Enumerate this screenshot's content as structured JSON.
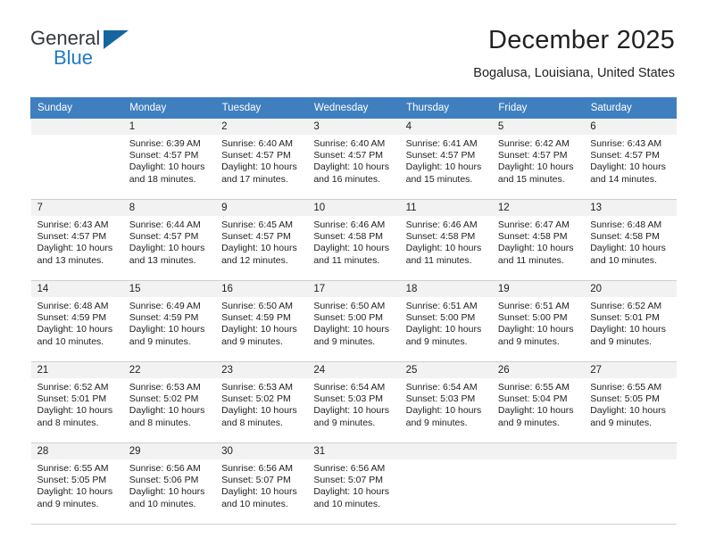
{
  "brand": {
    "word_one": "General",
    "word_two": "Blue",
    "logo_icon": "triangle-logo-icon",
    "accent_color": "#1e7bc4",
    "logo_color": "#15659f"
  },
  "header": {
    "month_title": "December 2025",
    "location": "Bogalusa, Louisiana, United States"
  },
  "calendar": {
    "header_bg": "#3f7fbf",
    "daynum_bg": "#f2f2f2",
    "weekday_headers": [
      "Sunday",
      "Monday",
      "Tuesday",
      "Wednesday",
      "Thursday",
      "Friday",
      "Saturday"
    ],
    "weeks": [
      [
        {
          "day": "",
          "blank": true,
          "sunrise": "",
          "sunset": "",
          "daylight": ""
        },
        {
          "day": "1",
          "blank": false,
          "sunrise": "Sunrise: 6:39 AM",
          "sunset": "Sunset: 4:57 PM",
          "daylight": "Daylight: 10 hours and 18 minutes."
        },
        {
          "day": "2",
          "blank": false,
          "sunrise": "Sunrise: 6:40 AM",
          "sunset": "Sunset: 4:57 PM",
          "daylight": "Daylight: 10 hours and 17 minutes."
        },
        {
          "day": "3",
          "blank": false,
          "sunrise": "Sunrise: 6:40 AM",
          "sunset": "Sunset: 4:57 PM",
          "daylight": "Daylight: 10 hours and 16 minutes."
        },
        {
          "day": "4",
          "blank": false,
          "sunrise": "Sunrise: 6:41 AM",
          "sunset": "Sunset: 4:57 PM",
          "daylight": "Daylight: 10 hours and 15 minutes."
        },
        {
          "day": "5",
          "blank": false,
          "sunrise": "Sunrise: 6:42 AM",
          "sunset": "Sunset: 4:57 PM",
          "daylight": "Daylight: 10 hours and 15 minutes."
        },
        {
          "day": "6",
          "blank": false,
          "sunrise": "Sunrise: 6:43 AM",
          "sunset": "Sunset: 4:57 PM",
          "daylight": "Daylight: 10 hours and 14 minutes."
        }
      ],
      [
        {
          "day": "7",
          "blank": false,
          "sunrise": "Sunrise: 6:43 AM",
          "sunset": "Sunset: 4:57 PM",
          "daylight": "Daylight: 10 hours and 13 minutes."
        },
        {
          "day": "8",
          "blank": false,
          "sunrise": "Sunrise: 6:44 AM",
          "sunset": "Sunset: 4:57 PM",
          "daylight": "Daylight: 10 hours and 13 minutes."
        },
        {
          "day": "9",
          "blank": false,
          "sunrise": "Sunrise: 6:45 AM",
          "sunset": "Sunset: 4:57 PM",
          "daylight": "Daylight: 10 hours and 12 minutes."
        },
        {
          "day": "10",
          "blank": false,
          "sunrise": "Sunrise: 6:46 AM",
          "sunset": "Sunset: 4:58 PM",
          "daylight": "Daylight: 10 hours and 11 minutes."
        },
        {
          "day": "11",
          "blank": false,
          "sunrise": "Sunrise: 6:46 AM",
          "sunset": "Sunset: 4:58 PM",
          "daylight": "Daylight: 10 hours and 11 minutes."
        },
        {
          "day": "12",
          "blank": false,
          "sunrise": "Sunrise: 6:47 AM",
          "sunset": "Sunset: 4:58 PM",
          "daylight": "Daylight: 10 hours and 11 minutes."
        },
        {
          "day": "13",
          "blank": false,
          "sunrise": "Sunrise: 6:48 AM",
          "sunset": "Sunset: 4:58 PM",
          "daylight": "Daylight: 10 hours and 10 minutes."
        }
      ],
      [
        {
          "day": "14",
          "blank": false,
          "sunrise": "Sunrise: 6:48 AM",
          "sunset": "Sunset: 4:59 PM",
          "daylight": "Daylight: 10 hours and 10 minutes."
        },
        {
          "day": "15",
          "blank": false,
          "sunrise": "Sunrise: 6:49 AM",
          "sunset": "Sunset: 4:59 PM",
          "daylight": "Daylight: 10 hours and 9 minutes."
        },
        {
          "day": "16",
          "blank": false,
          "sunrise": "Sunrise: 6:50 AM",
          "sunset": "Sunset: 4:59 PM",
          "daylight": "Daylight: 10 hours and 9 minutes."
        },
        {
          "day": "17",
          "blank": false,
          "sunrise": "Sunrise: 6:50 AM",
          "sunset": "Sunset: 5:00 PM",
          "daylight": "Daylight: 10 hours and 9 minutes."
        },
        {
          "day": "18",
          "blank": false,
          "sunrise": "Sunrise: 6:51 AM",
          "sunset": "Sunset: 5:00 PM",
          "daylight": "Daylight: 10 hours and 9 minutes."
        },
        {
          "day": "19",
          "blank": false,
          "sunrise": "Sunrise: 6:51 AM",
          "sunset": "Sunset: 5:00 PM",
          "daylight": "Daylight: 10 hours and 9 minutes."
        },
        {
          "day": "20",
          "blank": false,
          "sunrise": "Sunrise: 6:52 AM",
          "sunset": "Sunset: 5:01 PM",
          "daylight": "Daylight: 10 hours and 9 minutes."
        }
      ],
      [
        {
          "day": "21",
          "blank": false,
          "sunrise": "Sunrise: 6:52 AM",
          "sunset": "Sunset: 5:01 PM",
          "daylight": "Daylight: 10 hours and 8 minutes."
        },
        {
          "day": "22",
          "blank": false,
          "sunrise": "Sunrise: 6:53 AM",
          "sunset": "Sunset: 5:02 PM",
          "daylight": "Daylight: 10 hours and 8 minutes."
        },
        {
          "day": "23",
          "blank": false,
          "sunrise": "Sunrise: 6:53 AM",
          "sunset": "Sunset: 5:02 PM",
          "daylight": "Daylight: 10 hours and 8 minutes."
        },
        {
          "day": "24",
          "blank": false,
          "sunrise": "Sunrise: 6:54 AM",
          "sunset": "Sunset: 5:03 PM",
          "daylight": "Daylight: 10 hours and 9 minutes."
        },
        {
          "day": "25",
          "blank": false,
          "sunrise": "Sunrise: 6:54 AM",
          "sunset": "Sunset: 5:03 PM",
          "daylight": "Daylight: 10 hours and 9 minutes."
        },
        {
          "day": "26",
          "blank": false,
          "sunrise": "Sunrise: 6:55 AM",
          "sunset": "Sunset: 5:04 PM",
          "daylight": "Daylight: 10 hours and 9 minutes."
        },
        {
          "day": "27",
          "blank": false,
          "sunrise": "Sunrise: 6:55 AM",
          "sunset": "Sunset: 5:05 PM",
          "daylight": "Daylight: 10 hours and 9 minutes."
        }
      ],
      [
        {
          "day": "28",
          "blank": false,
          "sunrise": "Sunrise: 6:55 AM",
          "sunset": "Sunset: 5:05 PM",
          "daylight": "Daylight: 10 hours and 9 minutes."
        },
        {
          "day": "29",
          "blank": false,
          "sunrise": "Sunrise: 6:56 AM",
          "sunset": "Sunset: 5:06 PM",
          "daylight": "Daylight: 10 hours and 10 minutes."
        },
        {
          "day": "30",
          "blank": false,
          "sunrise": "Sunrise: 6:56 AM",
          "sunset": "Sunset: 5:07 PM",
          "daylight": "Daylight: 10 hours and 10 minutes."
        },
        {
          "day": "31",
          "blank": false,
          "sunrise": "Sunrise: 6:56 AM",
          "sunset": "Sunset: 5:07 PM",
          "daylight": "Daylight: 10 hours and 10 minutes."
        },
        {
          "day": "",
          "blank": true,
          "sunrise": "",
          "sunset": "",
          "daylight": ""
        },
        {
          "day": "",
          "blank": true,
          "sunrise": "",
          "sunset": "",
          "daylight": ""
        },
        {
          "day": "",
          "blank": true,
          "sunrise": "",
          "sunset": "",
          "daylight": ""
        }
      ]
    ]
  }
}
